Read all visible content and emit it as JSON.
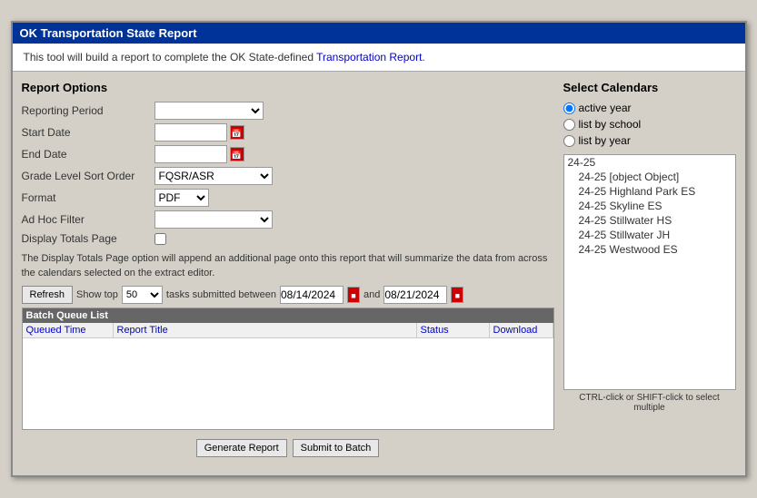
{
  "window": {
    "title": "OK Transportation State Report"
  },
  "info_bar": {
    "text_before": "This tool will build a report to complete the OK State-defined ",
    "link_text": "Transportation Report",
    "text_after": "."
  },
  "form": {
    "report_options_label": "Report Options",
    "fields": {
      "reporting_period_label": "Reporting Period",
      "start_date_label": "Start Date",
      "end_date_label": "End Date",
      "grade_level_sort_label": "Grade Level Sort Order",
      "grade_level_sort_value": "FQSR/ASR",
      "format_label": "Format",
      "format_value": "PDF",
      "adhoc_filter_label": "Ad Hoc Filter",
      "display_totals_label": "Display Totals Page"
    },
    "description": "The Display Totals Page option will append an additional page onto this report that will summarize the data from across the calendars selected on the extract editor.",
    "batch": {
      "refresh_label": "Refresh",
      "show_top_label": "Show top",
      "show_top_value": "50",
      "tasks_label": "tasks submitted between",
      "date_start": "08/14/2024",
      "and_label": "and",
      "date_end": "08/21/2024",
      "queue_header": "Batch Queue List",
      "col_queued_time": "Queued Time",
      "col_report_title": "Report Title",
      "col_status": "Status",
      "col_download": "Download"
    },
    "generate_btn": "Generate Report",
    "submit_btn": "Submit to Batch"
  },
  "calendars": {
    "title": "Select Calendars",
    "radio_options": [
      {
        "id": "active_year",
        "label": "active year",
        "checked": true
      },
      {
        "id": "list_by_school",
        "label": "list by school",
        "checked": false
      },
      {
        "id": "list_by_year",
        "label": "list by year",
        "checked": false
      }
    ],
    "list_items": [
      {
        "text": "24-25",
        "indent": false
      },
      {
        "text": "24-25 [object Object]",
        "indent": true
      },
      {
        "text": "24-25 Highland Park ES",
        "indent": true
      },
      {
        "text": "24-25 Skyline ES",
        "indent": true
      },
      {
        "text": "24-25 Stillwater HS",
        "indent": true
      },
      {
        "text": "24-25 Stillwater JH",
        "indent": true
      },
      {
        "text": "24-25 Westwood ES",
        "indent": true
      }
    ],
    "ctrl_hint": "CTRL-click or SHIFT-click to select multiple"
  }
}
